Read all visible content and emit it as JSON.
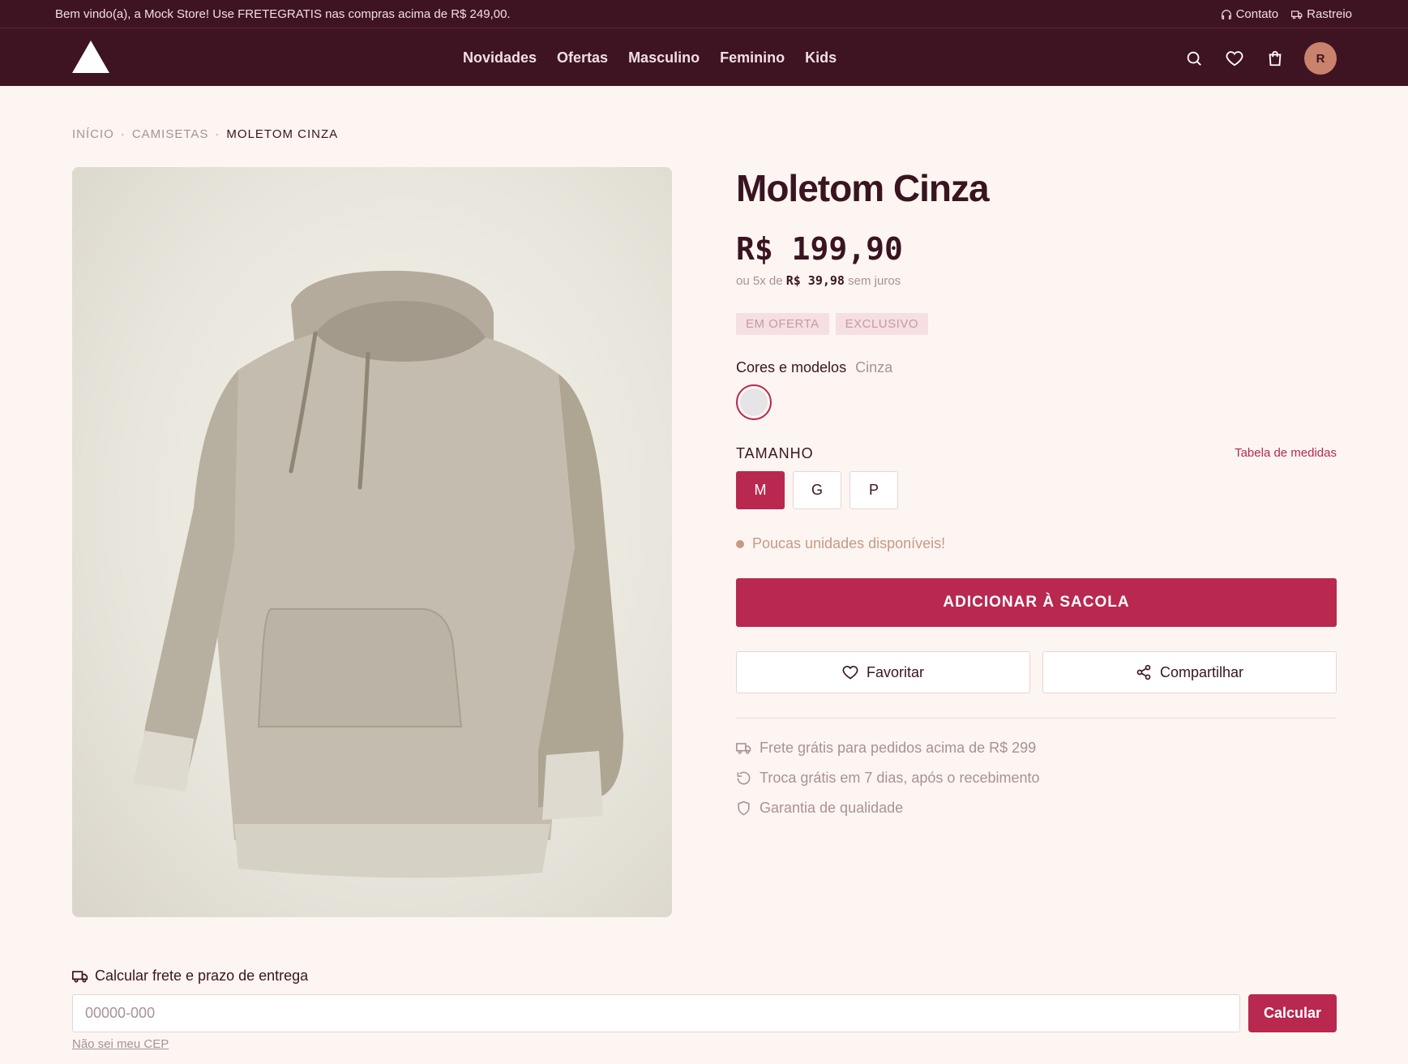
{
  "topbar": {
    "message": "Bem vindo(a), a Mock Store! Use FRETEGRATIS nas compras acima de R$ 249,00.",
    "contact": "Contato",
    "tracking": "Rastreio"
  },
  "header": {
    "nav": [
      "Novidades",
      "Ofertas",
      "Masculino",
      "Feminino",
      "Kids"
    ],
    "avatar_initial": "R"
  },
  "breadcrumb": {
    "home": "INÍCIO",
    "category": "CAMISETAS",
    "current": "MOLETOM CINZA",
    "separator": "·"
  },
  "product": {
    "title": "Moletom Cinza",
    "price": "R$ 199,90",
    "installments_prefix": "ou 5x de",
    "installment_value": "R$ 39,98",
    "installments_suffix": "sem juros",
    "badges": [
      "EM OFERTA",
      "EXCLUSIVO"
    ],
    "colors_label": "Cores e modelos",
    "selected_color": "Cinza",
    "size_label": "TAMANHO",
    "size_table_link": "Tabela de medidas",
    "sizes": [
      "M",
      "G",
      "P"
    ],
    "selected_size": "M",
    "stock_message": "Poucas unidades disponíveis!",
    "add_to_cart": "ADICIONAR À SACOLA",
    "favorite": "Favoritar",
    "share": "Compartilhar",
    "perks": [
      "Frete grátis para pedidos acima de R$ 299",
      "Troca grátis em 7 dias, após o recebimento",
      "Garantia de qualidade"
    ]
  },
  "shipping": {
    "title": "Calcular frete e prazo de entrega",
    "placeholder": "00000-000",
    "button": "Calcular",
    "no_cep_link": "Não sei meu CEP"
  },
  "colors": {
    "brand_dark": "#3f1422",
    "accent": "#b8284f",
    "background": "#fdf5f2"
  }
}
